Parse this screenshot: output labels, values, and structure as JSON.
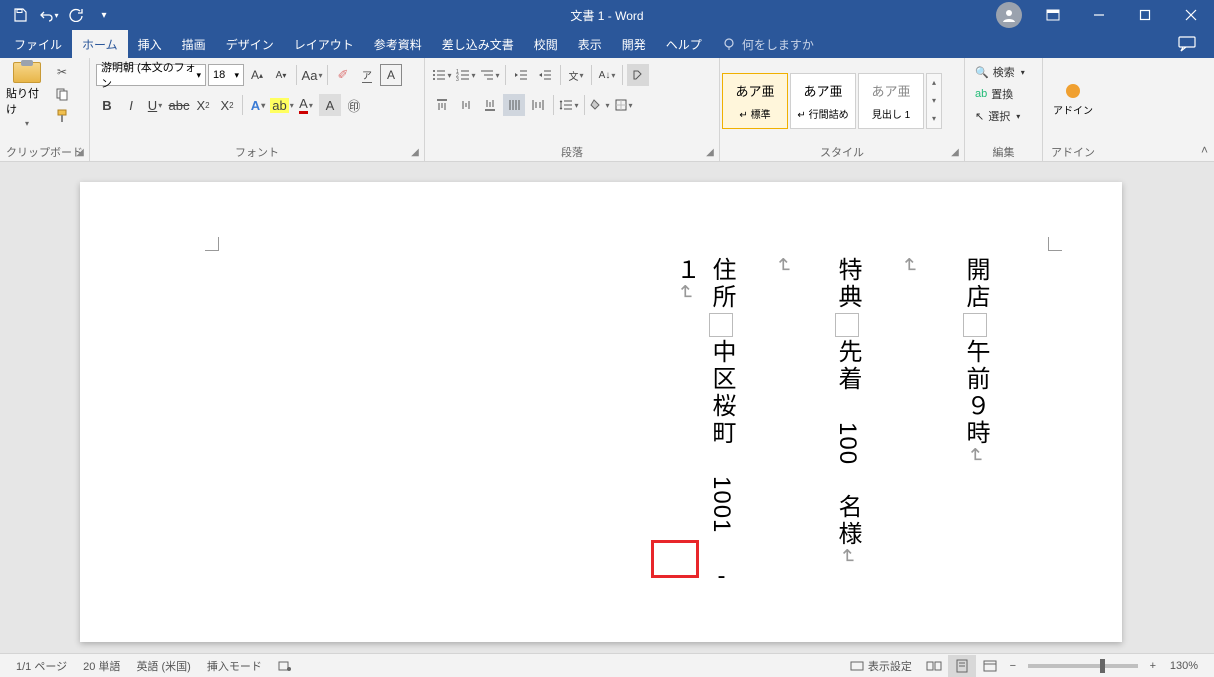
{
  "titlebar": {
    "title": "文書 1  -  Word"
  },
  "menu": {
    "file": "ファイル",
    "home": "ホーム",
    "insert": "挿入",
    "draw": "描画",
    "design": "デザイン",
    "layout": "レイアウト",
    "references": "参考資料",
    "mailings": "差し込み文書",
    "review": "校閲",
    "view": "表示",
    "developer": "開発",
    "help": "ヘルプ",
    "tellme": "何をしますか"
  },
  "ribbon": {
    "clipboard": {
      "label": "クリップボード",
      "paste": "貼り付け"
    },
    "font": {
      "label": "フォント",
      "name": "游明朝 (本文のフォン",
      "size": "18"
    },
    "paragraph": {
      "label": "段落"
    },
    "styles": {
      "label": "スタイル",
      "sample": "あア亜",
      "s1": "標準",
      "s2": "行間詰め",
      "s3": "見出し 1"
    },
    "editing": {
      "label": "編集",
      "find": "検索",
      "replace": "置換",
      "select": "選択"
    },
    "addin": {
      "label": "アドイン",
      "btn": "アドイン"
    }
  },
  "document": {
    "line1": "開店　午前９時",
    "line3": "特典　先着 100 名様",
    "line5_a": "住所　中区桜町",
    "line5_b": "1001",
    "line5_c": "-",
    "line5_d": "１"
  },
  "status": {
    "page": "1/1 ページ",
    "words": "20 単語",
    "lang": "英語 (米国)",
    "insert": "挿入モード",
    "display": "表示設定",
    "zoom": "130%"
  }
}
